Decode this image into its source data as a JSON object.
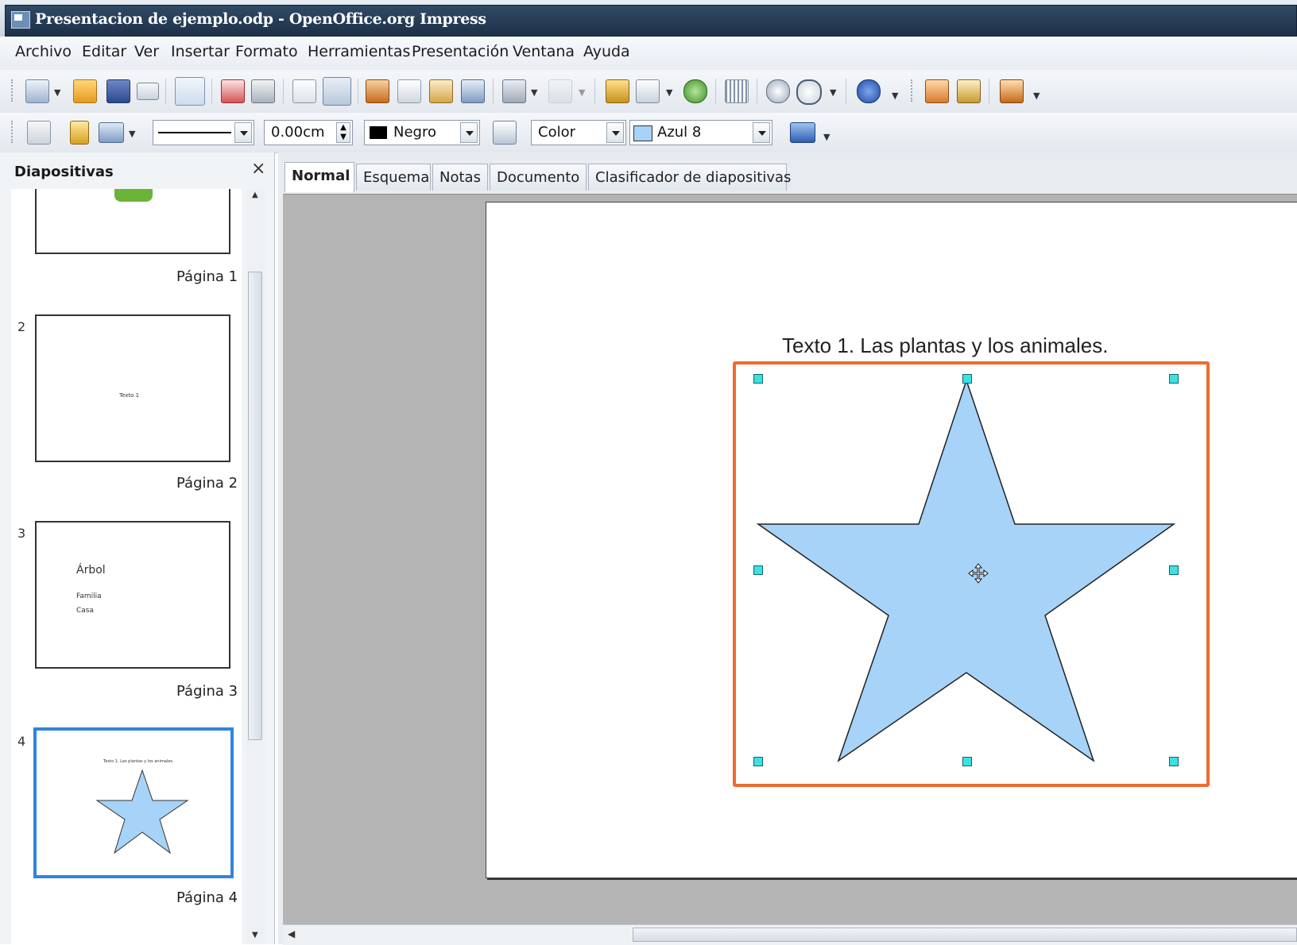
{
  "window": {
    "title": "Presentacion de ejemplo.odp - OpenOffice.org Impress"
  },
  "menu": [
    "Archivo",
    "Editar",
    "Ver",
    "Insertar",
    "Formato",
    "Herramientas",
    "Presentación",
    "Ventana",
    "Ayuda"
  ],
  "toolbar2": {
    "line_width": "0.00cm",
    "line_color": "Negro",
    "area_style": "Color",
    "area_color": "Azul 8"
  },
  "slides_panel": {
    "title": "Diapositivas",
    "close_symbol": "×",
    "slides": [
      {
        "number": "",
        "label": "Página 1"
      },
      {
        "number": "2",
        "label": "Página 2",
        "content": [
          "Texto 1"
        ]
      },
      {
        "number": "3",
        "label": "Página 3",
        "content": [
          "Árbol",
          "Familia",
          "Casa"
        ]
      },
      {
        "number": "4",
        "label": "Página 4",
        "content": [
          "Texto 1. Las plantas y los animales."
        ]
      }
    ]
  },
  "view_tabs": [
    "Normal",
    "Esquema",
    "Notas",
    "Documento",
    "Clasificador de diapositivas"
  ],
  "active_tab": "Normal",
  "slide": {
    "title": "Texto 1. Las plantas y los animales.",
    "shape": "star",
    "shape_fill": "#a6d3f7",
    "selection_color": "#ec6d2e",
    "handle_color": "#3fe0e0"
  },
  "icons": [
    "new-icon",
    "open-icon",
    "save-icon",
    "email-icon",
    "edit-file-icon",
    "export-pdf-icon",
    "print-icon",
    "spellcheck-icon",
    "autospellcheck-icon",
    "cut-icon",
    "copy-icon",
    "paste-icon",
    "format-paintbrush-icon",
    "undo-icon",
    "redo-icon",
    "chart-icon",
    "table-icon",
    "gallery-icon",
    "grid-icon",
    "navigator-icon",
    "zoom-icon",
    "help-icon"
  ]
}
